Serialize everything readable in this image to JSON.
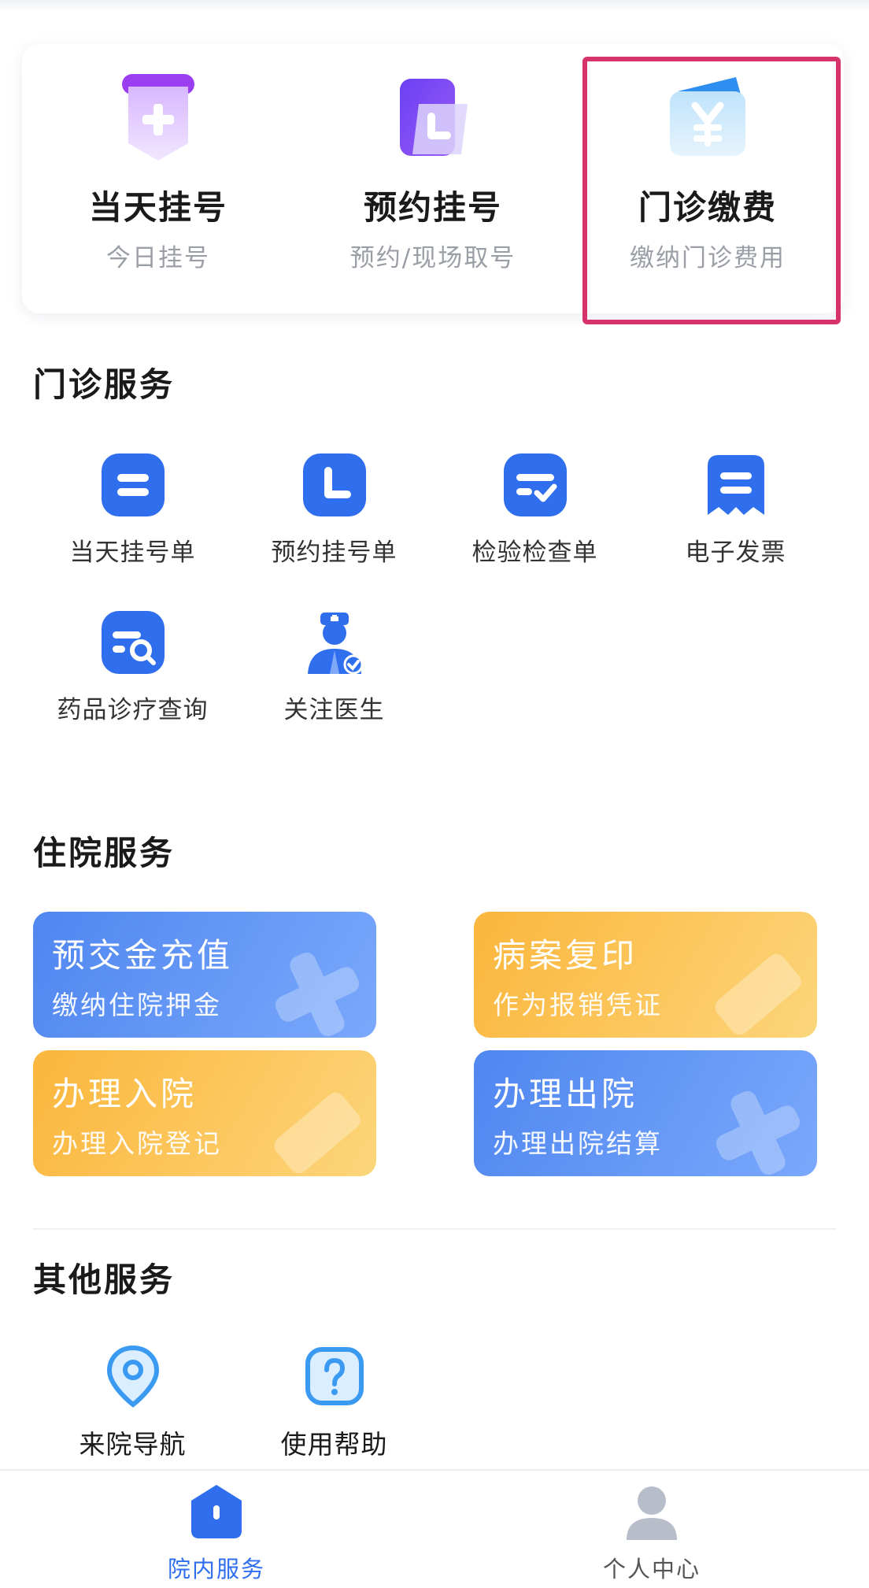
{
  "quick": [
    {
      "title": "当天挂号",
      "subtitle": "今日挂号",
      "icon": "plus-calendar-icon"
    },
    {
      "title": "预约挂号",
      "subtitle": "预约/现场取号",
      "icon": "clock-folder-icon"
    },
    {
      "title": "门诊缴费",
      "subtitle": "缴纳门诊费用",
      "icon": "yuan-wallet-icon"
    }
  ],
  "outpatient": {
    "title": "门诊服务",
    "items": [
      {
        "label": "当天挂号单",
        "icon": "list-icon"
      },
      {
        "label": "预约挂号单",
        "icon": "clock-icon"
      },
      {
        "label": "检验检查单",
        "icon": "checklist-icon"
      },
      {
        "label": "电子发票",
        "icon": "invoice-icon"
      },
      {
        "label": "药品诊疗查询",
        "icon": "search-doc-icon"
      },
      {
        "label": "关注医生",
        "icon": "doctor-icon"
      }
    ]
  },
  "inpatient": {
    "title": "住院服务",
    "tiles": [
      {
        "title": "预交金充值",
        "subtitle": "缴纳住院押金"
      },
      {
        "title": "病案复印",
        "subtitle": "作为报销凭证"
      },
      {
        "title": "办理入院",
        "subtitle": "办理入院登记"
      },
      {
        "title": "办理出院",
        "subtitle": "办理出院结算"
      }
    ]
  },
  "other": {
    "title": "其他服务",
    "items": [
      {
        "label": "来院导航",
        "icon": "location-pin-icon"
      },
      {
        "label": "使用帮助",
        "icon": "question-icon"
      }
    ]
  },
  "nav": [
    {
      "label": "院内服务",
      "icon": "home-icon",
      "active": true
    },
    {
      "label": "个人中心",
      "icon": "user-icon",
      "active": false
    }
  ],
  "colors": {
    "accent": "#2f6fee",
    "highlight": "#d6336c",
    "tile_blue": "#4f86f0",
    "tile_orange": "#fbb63c"
  }
}
